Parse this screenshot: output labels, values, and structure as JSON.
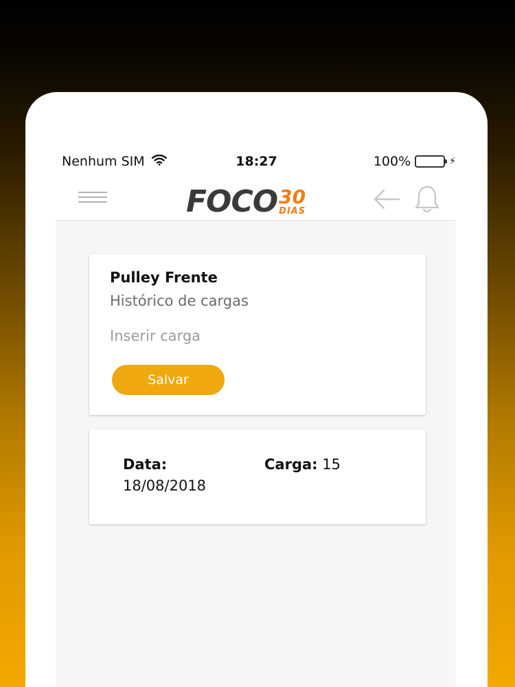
{
  "status_bar": {
    "carrier": "Nenhum SIM",
    "time": "18:27",
    "battery": "100%",
    "battery_level": 1.0,
    "battery_color": "#2ecc40"
  },
  "header": {
    "logo": {
      "main": "FOCO",
      "number": "30",
      "sub": "DIAS"
    },
    "icons": [
      "menu-icon",
      "back-arrow-icon",
      "bell-icon"
    ],
    "accent_color": "#f07d14"
  },
  "form_card": {
    "title": "Pulley Frente",
    "subtitle": "Histórico de cargas",
    "input_placeholder": "Inserir carga",
    "input_value": "",
    "save_label": "Salvar",
    "button_color": "#efa80e"
  },
  "history": [
    {
      "date_label": "Data:",
      "date": "18/08/2018",
      "load_label": "Carga:",
      "load": "15"
    }
  ]
}
